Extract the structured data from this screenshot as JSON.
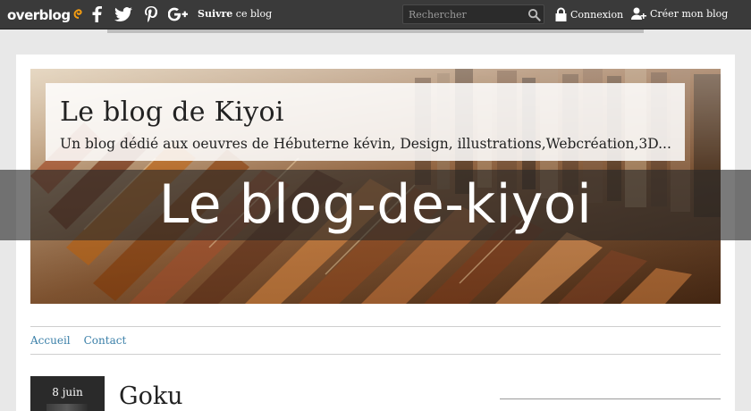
{
  "topbar": {
    "logo": "overblog",
    "follow_bold": "Suivre",
    "follow_rest": " ce blog",
    "search_placeholder": "Rechercher",
    "login": "Connexion",
    "create_blog": "Créer mon blog",
    "social_icons": [
      "facebook-icon",
      "twitter-icon",
      "pinterest-icon",
      "google-plus-icon"
    ]
  },
  "header": {
    "title": "Le blog de Kiyoi",
    "subtitle": "Un blog dédié aux oeuvres de Hébuterne kévin, Design, illustrations,Webcréation,3D..."
  },
  "overlay": {
    "text": "Le blog-de-kiyoi"
  },
  "nav": {
    "items": [
      {
        "label": "Accueil"
      },
      {
        "label": "Contact"
      }
    ]
  },
  "post": {
    "date": "8 juin",
    "title": "Goku"
  },
  "colors": {
    "topbar": "#3a3a3a",
    "link": "#3a7fa8",
    "overlay": "#282828"
  }
}
